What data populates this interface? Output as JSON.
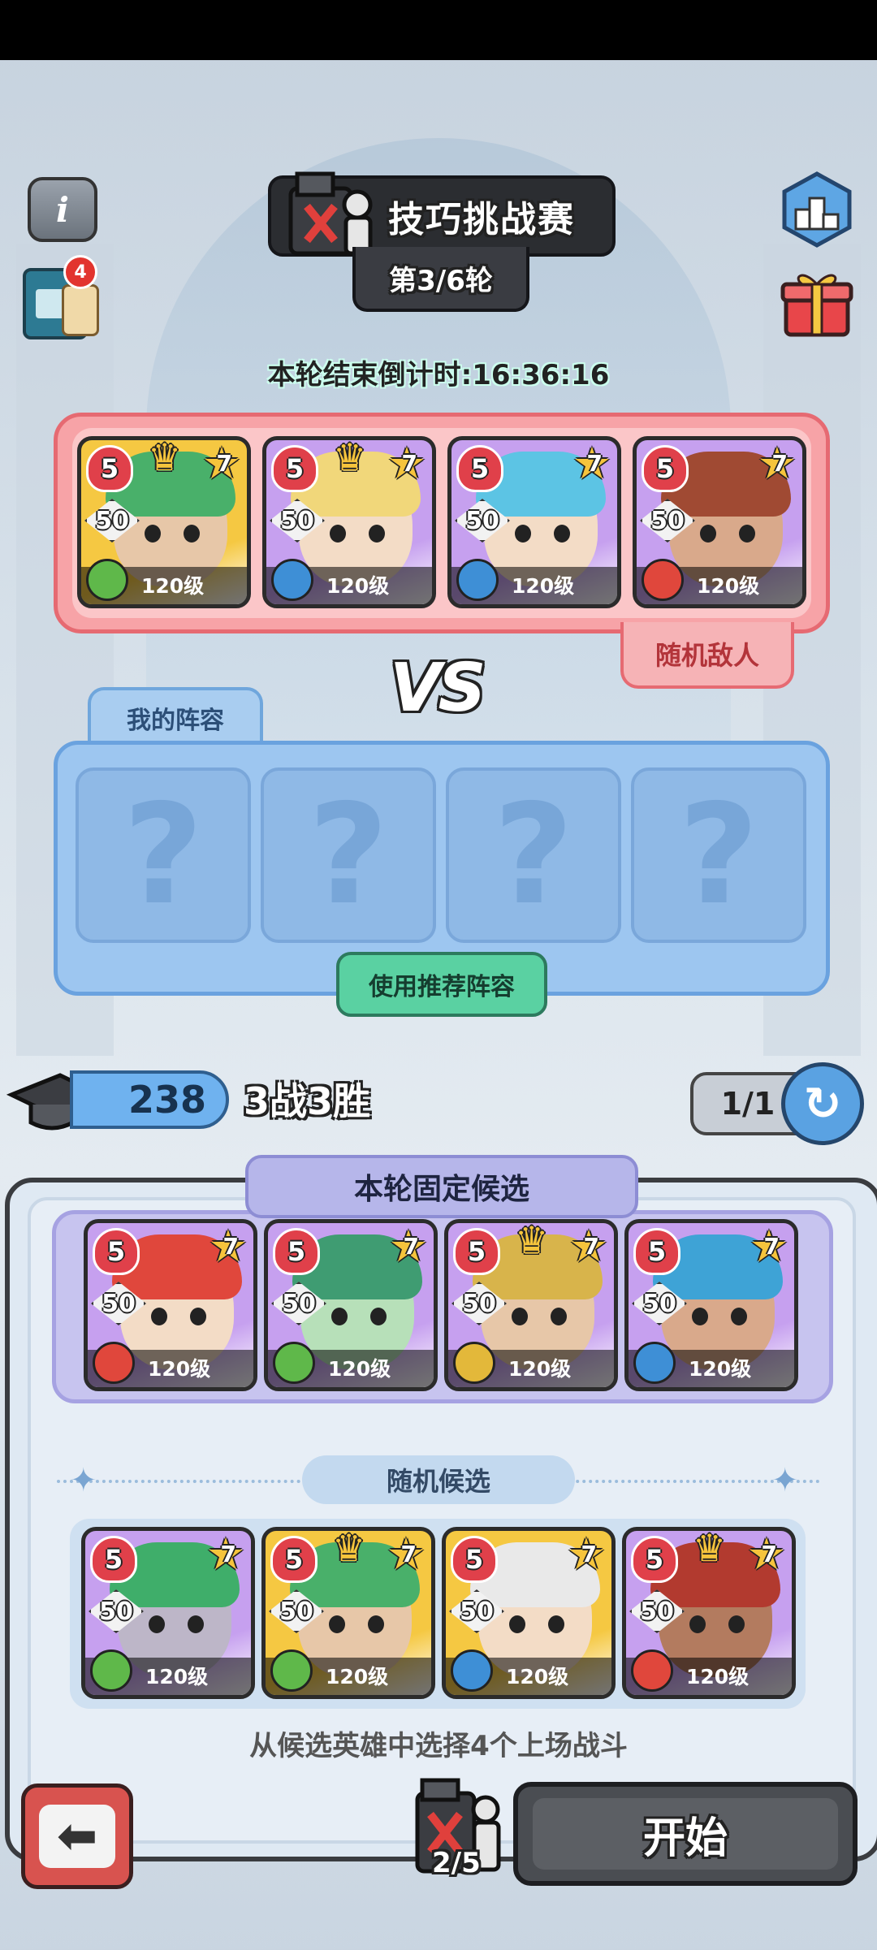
{
  "header": {
    "title": "技巧挑战赛",
    "round": "第3/6轮",
    "countdown": "本轮结束倒计时:16:36:16",
    "book_badge": "4"
  },
  "enemy": {
    "tag": "随机敌人",
    "heroes": [
      {
        "stars": "5",
        "power": "50",
        "grade": "7",
        "level": "120级",
        "element": "wind",
        "crown": true,
        "palette": [
          "#f5c842",
          "#49b06a",
          "#e7c7a8"
        ]
      },
      {
        "stars": "5",
        "power": "50",
        "grade": "7",
        "level": "120级",
        "element": "water",
        "crown": true,
        "palette": [
          "#c6a0ef",
          "#f1d77a",
          "#f3dcc6"
        ]
      },
      {
        "stars": "5",
        "power": "50",
        "grade": "7",
        "level": "120级",
        "element": "water",
        "crown": false,
        "palette": [
          "#c6a0ef",
          "#5cc4e4",
          "#f3dcc6"
        ]
      },
      {
        "stars": "5",
        "power": "50",
        "grade": "7",
        "level": "120级",
        "element": "fire",
        "crown": false,
        "palette": [
          "#c6a0ef",
          "#a04a33",
          "#d9a98b"
        ]
      }
    ]
  },
  "vs_label": "VS",
  "my_lineup": {
    "tab": "我的阵容",
    "empty_slot": "?",
    "recommend_button": "使用推荐阵容"
  },
  "score": {
    "points": "238",
    "record": "3战3胜",
    "refresh_count": "1/1"
  },
  "candidates": {
    "fixed_tab": "本轮固定候选",
    "fixed": [
      {
        "stars": "5",
        "power": "50",
        "grade": "7",
        "level": "120级",
        "element": "fire",
        "crown": false,
        "palette": [
          "#c6a0ef",
          "#e0473c",
          "#f3dcc6"
        ]
      },
      {
        "stars": "5",
        "power": "50",
        "grade": "7",
        "level": "120级",
        "element": "wind",
        "crown": false,
        "palette": [
          "#c6a0ef",
          "#3f9c72",
          "#b7e0b9"
        ]
      },
      {
        "stars": "5",
        "power": "50",
        "grade": "7",
        "level": "120级",
        "element": "earth",
        "crown": true,
        "palette": [
          "#c6a0ef",
          "#d8b44b",
          "#e7c7a8"
        ]
      },
      {
        "stars": "5",
        "power": "50",
        "grade": "7",
        "level": "120级",
        "element": "water",
        "crown": false,
        "palette": [
          "#c6a0ef",
          "#3ea3d6",
          "#d9a98b"
        ]
      }
    ],
    "random_tab": "随机候选",
    "random": [
      {
        "stars": "5",
        "power": "50",
        "grade": "7",
        "level": "120级",
        "element": "wind",
        "crown": false,
        "palette": [
          "#c6a0ef",
          "#3fae6a",
          "#bdb6c8"
        ]
      },
      {
        "stars": "5",
        "power": "50",
        "grade": "7",
        "level": "120级",
        "element": "wind",
        "crown": true,
        "palette": [
          "#f5c842",
          "#49b06a",
          "#e7c7a8"
        ]
      },
      {
        "stars": "5",
        "power": "50",
        "grade": "7",
        "level": "120级",
        "element": "water",
        "crown": false,
        "palette": [
          "#f5c842",
          "#e9e9e9",
          "#f3dcc6"
        ]
      },
      {
        "stars": "5",
        "power": "50",
        "grade": "7",
        "level": "120级",
        "element": "fire",
        "crown": true,
        "palette": [
          "#c6a0ef",
          "#b23a2f",
          "#b37b5f"
        ]
      }
    ],
    "hint": "从候选英雄中选择4个上场战斗"
  },
  "footer": {
    "ticket_count": "2/5",
    "start_button": "开始"
  },
  "element_colors": {
    "wind": "#5fb84a",
    "water": "#3e8fd6",
    "fire": "#e0473c",
    "earth": "#e3b83a"
  },
  "element_glyphs": {
    "wind": "◎",
    "water": "●",
    "fire": "●",
    "earth": "●"
  }
}
